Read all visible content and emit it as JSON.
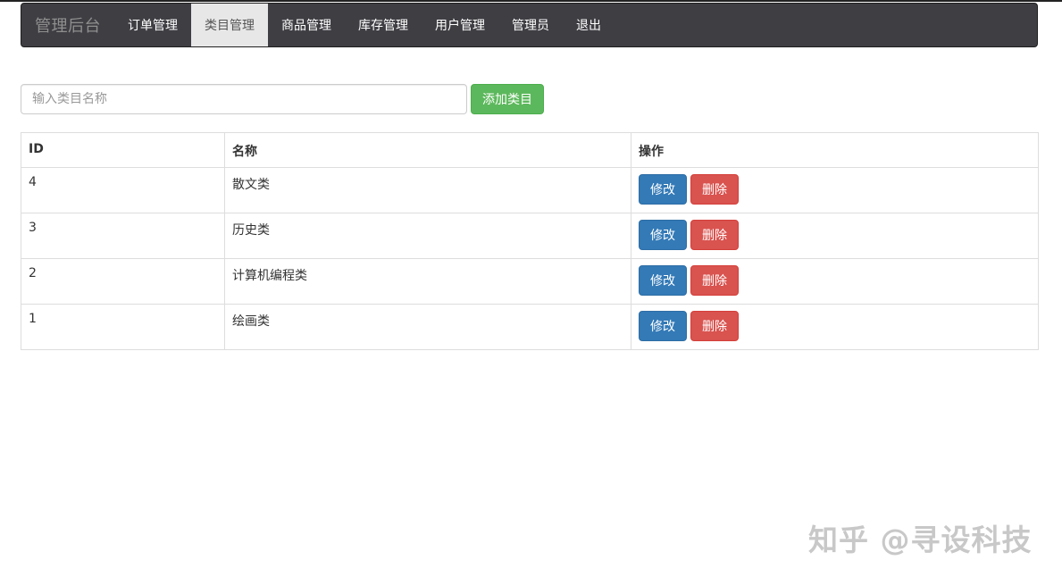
{
  "navbar": {
    "brand": "管理后台",
    "items": [
      {
        "label": "订单管理",
        "active": false
      },
      {
        "label": "类目管理",
        "active": true
      },
      {
        "label": "商品管理",
        "active": false
      },
      {
        "label": "库存管理",
        "active": false
      },
      {
        "label": "用户管理",
        "active": false
      },
      {
        "label": "管理员",
        "active": false
      },
      {
        "label": "退出",
        "active": false
      }
    ]
  },
  "search": {
    "placeholder": "输入类目名称",
    "value": "",
    "add_label": "添加类目"
  },
  "table": {
    "headers": [
      "ID",
      "名称",
      "操作"
    ],
    "rows": [
      {
        "id": "4",
        "name": "散文类"
      },
      {
        "id": "3",
        "name": "历史类"
      },
      {
        "id": "2",
        "name": "计算机编程类"
      },
      {
        "id": "1",
        "name": "绘画类"
      }
    ],
    "edit_label": "修改",
    "delete_label": "删除"
  },
  "watermark": "知乎 @寻设科技",
  "colors": {
    "navbar_bg": "#3f3e43",
    "success": "#5cb85c",
    "primary": "#337ab7",
    "danger": "#d9534f"
  }
}
